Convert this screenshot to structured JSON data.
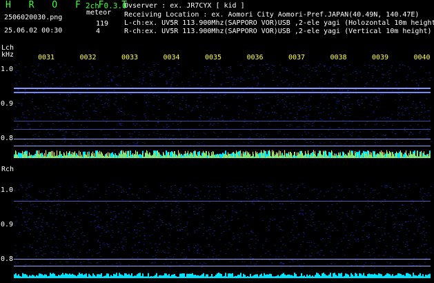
{
  "header": {
    "brand": "H R O F F T",
    "channel_info": "2ch 0.3.0",
    "filename": "2506020030.png",
    "datetime": "25.06.02 00:30",
    "meteor_label": "meteor",
    "meteor_count_l": "119",
    "meteor_count_r": "4",
    "observer": "Ovserver              : ex. JR7CYX [ kid ]",
    "location": "Receiving Location : ex. Aomori City Aomori-Pref.JAPAN(40.49N, 140.47E)",
    "lch_info": "L-ch:ex. UV5R 113.900Mhz(SAPPORO VOR)USB ,2-ele yagi (Holozontal 10m height)",
    "rch_info": "R-ch:ex. UV5R 113.900Mhz(SAPPORO VOR)USB ,2-ele yagi (Vertical 10m height)"
  },
  "lch": {
    "label": "Lch",
    "unit": "kHz",
    "y_labels": [
      "1.0",
      "0.9",
      "0.8"
    ]
  },
  "rch": {
    "label": "Rch",
    "y_labels": [
      "1.0",
      "0.9",
      "0.8"
    ]
  },
  "time_ticks": [
    "0031",
    "0032",
    "0033",
    "0034",
    "0035",
    "0036",
    "0037",
    "0038",
    "0039",
    "0040"
  ],
  "colors": {
    "background": "#000000",
    "brand": "#3cff3c",
    "tick": "#ffff3c",
    "signal_line": "#8fa8ff",
    "power_yellow": "#ffff00",
    "power_cyan": "#00e5ff"
  }
}
